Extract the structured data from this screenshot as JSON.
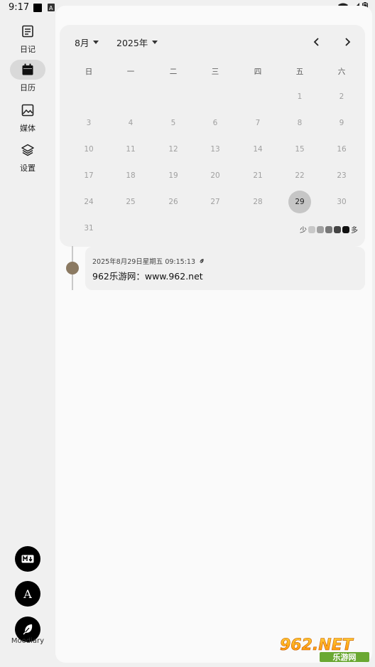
{
  "status_bar": {
    "time": "9:17"
  },
  "sidebar": {
    "items": [
      {
        "label": "日记",
        "icon": "diary-icon",
        "active": false
      },
      {
        "label": "日历",
        "icon": "calendar-icon",
        "active": true
      },
      {
        "label": "媒体",
        "icon": "image-icon",
        "active": false
      },
      {
        "label": "设置",
        "icon": "layers-icon",
        "active": false
      }
    ],
    "actions": [
      {
        "icon": "markdown-icon",
        "label": "M↓"
      },
      {
        "icon": "font-icon",
        "label": "A"
      },
      {
        "icon": "feather-icon"
      }
    ],
    "app_name": "Moodiary"
  },
  "calendar": {
    "month": "8月",
    "year": "2025年",
    "weekdays": [
      "日",
      "一",
      "二",
      "三",
      "四",
      "五",
      "六"
    ],
    "days": [
      "1",
      "2",
      "3",
      "4",
      "5",
      "6",
      "7",
      "8",
      "9",
      "10",
      "11",
      "12",
      "13",
      "14",
      "15",
      "16",
      "17",
      "18",
      "19",
      "20",
      "21",
      "22",
      "23",
      "24",
      "25",
      "26",
      "27",
      "28",
      "29",
      "30",
      "31"
    ],
    "first_weekday_index": 5,
    "selected_day": "29",
    "legend": {
      "less": "少",
      "more": "多",
      "colors": [
        "#c8c8c8",
        "#a0a0a0",
        "#777777",
        "#444444",
        "#111111"
      ]
    }
  },
  "entries": [
    {
      "datetime": "2025年8月29日星期五 09:15:13",
      "text": "962乐游网：www.962.net",
      "mood_color": "#8b7a62"
    }
  ],
  "watermark": {
    "brand": "962.NET",
    "subtitle": "乐游网"
  }
}
